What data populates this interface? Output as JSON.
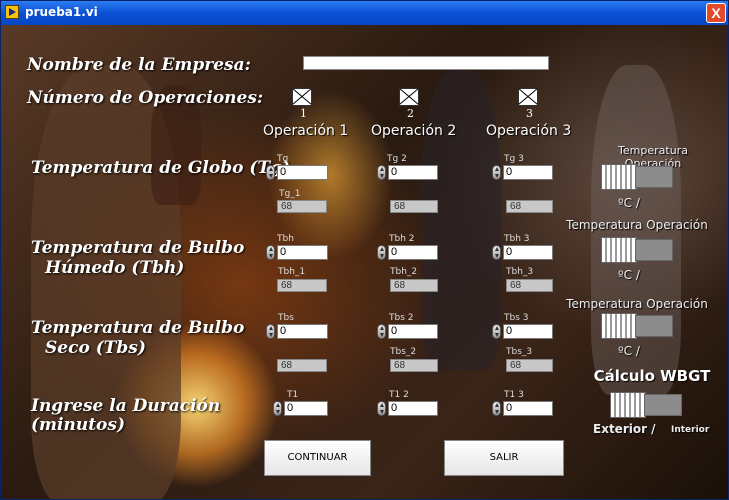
{
  "window": {
    "title": "prueba1.vi",
    "close": "X"
  },
  "labels": {
    "company": "Nombre de la Empresa:",
    "ops_count": "Número de Operaciones:",
    "tg": "Temperatura de Globo (Tg)",
    "tbh_1": "Temperatura de Bulbo",
    "tbh_2": "Húmedo (Tbh)",
    "tbs_1": "Temperatura de Bulbo",
    "tbs_2": "Seco (Tbs)",
    "dur_1": "Ingrese la Duración",
    "dur_2": "(minutos)"
  },
  "company_value": "",
  "operations": {
    "checkbox_numbers": [
      "1",
      "2",
      "3"
    ],
    "headers": [
      "Operación 1",
      "Operación 2",
      "Operación 3"
    ]
  },
  "tg": {
    "captions": [
      "Tg",
      "Tg 2",
      "Tg 3"
    ],
    "values": [
      "0",
      "0",
      "0"
    ],
    "ind_captions": [
      "Tg_1",
      "",
      ""
    ],
    "ind_values": [
      "68",
      "68",
      "68"
    ]
  },
  "tbh": {
    "captions": [
      "Tbh",
      "Tbh 2",
      "Tbh 3"
    ],
    "values": [
      "0",
      "0",
      "0"
    ],
    "ind_captions": [
      "Tbh_1",
      "Tbh_2",
      "Tbh_3"
    ],
    "ind_values": [
      "68",
      "68",
      "68"
    ]
  },
  "tbs": {
    "captions": [
      "Tbs",
      "Tbs 2",
      "Tbs 3"
    ],
    "values": [
      "0",
      "0",
      "0"
    ],
    "ind_captions": [
      "",
      "Tbs_2",
      "Tbs_3"
    ],
    "ind_values": [
      "68",
      "68",
      "68"
    ]
  },
  "dur": {
    "captions": [
      "T1",
      "T1 2",
      "T1 3"
    ],
    "values": [
      "0",
      "0",
      "0"
    ]
  },
  "right_panel": {
    "toggle1_label": "Temperatura Operación",
    "toggle1_units": "ºC /",
    "toggle2_label": "Temperatura Operación",
    "toggle2_units": "ºC /",
    "toggle3_label": "Temperatura Operación",
    "toggle3_units": "ºC /",
    "wbgt_title": "Cálculo WBGT",
    "wbgt_left": "Exterior /",
    "wbgt_right": "Interior"
  },
  "buttons": {
    "continue": "CONTINUAR",
    "exit": "SALIR"
  }
}
